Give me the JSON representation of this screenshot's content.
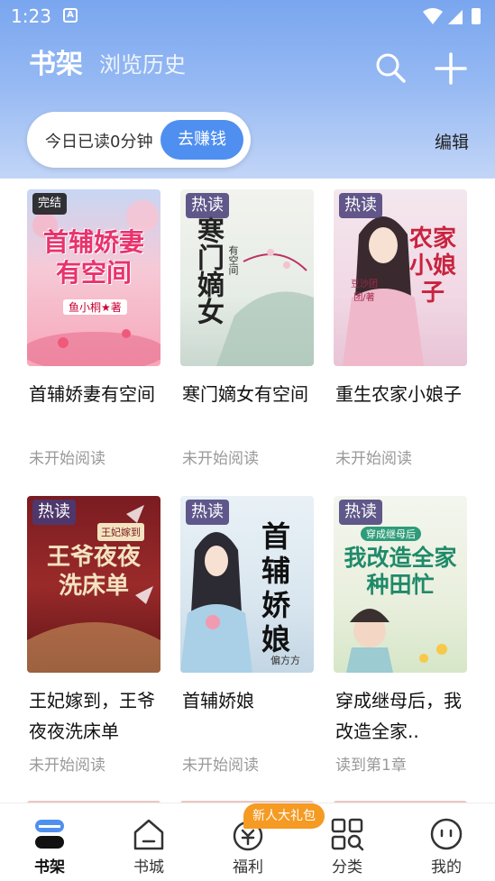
{
  "status_bar": {
    "time": "1:23",
    "app_icon_letter": "A"
  },
  "header": {
    "tab_active": "书架",
    "tab_inactive": "浏览历史",
    "reading_time": "今日已读0分钟",
    "earn_button": "去赚钱",
    "edit": "编辑"
  },
  "books": [
    {
      "title": "首辅娇妻有空间",
      "status": "未开始阅读",
      "badge": "完结",
      "cover_text": "首辅娇妻有空间",
      "cover_author": "鱼小桐★著"
    },
    {
      "title": "寒门嫡女有空间",
      "status": "未开始阅读",
      "badge": "热读",
      "cover_text": "寒门嫡女",
      "cover_author": "有空间"
    },
    {
      "title": "重生农家小娘子",
      "status": "未开始阅读",
      "badge": "热读",
      "cover_text": "农家小娘子",
      "cover_author": "豆沙团团/著"
    },
    {
      "title": "王妃嫁到，王爷夜夜洗床单",
      "status": "未开始阅读",
      "badge": "热读",
      "cover_text": "王爷夜夜洗床单",
      "cover_author": "王妃嫁到"
    },
    {
      "title": "首辅娇娘",
      "status": "未开始阅读",
      "badge": "热读",
      "cover_text": "首辅娇娘",
      "cover_author": "偏方方"
    },
    {
      "title": "穿成继母后，我改造全家..",
      "status": "读到第1章",
      "badge": "热读",
      "cover_text": "我改造全家种田忙",
      "cover_author": "穿成继母后"
    }
  ],
  "bottom_nav": {
    "items": [
      {
        "label": "书架",
        "icon": "bookshelf-icon",
        "active": true
      },
      {
        "label": "书城",
        "icon": "bookstore-icon",
        "active": false
      },
      {
        "label": "福利",
        "icon": "welfare-icon",
        "active": false
      },
      {
        "label": "分类",
        "icon": "category-icon",
        "active": false
      },
      {
        "label": "我的",
        "icon": "profile-icon",
        "active": false
      }
    ],
    "gift_badge": "新人大礼包"
  },
  "colors": {
    "accent": "#4f8ff0",
    "header_top": "#7aa6ef",
    "gift": "#f59a23"
  }
}
